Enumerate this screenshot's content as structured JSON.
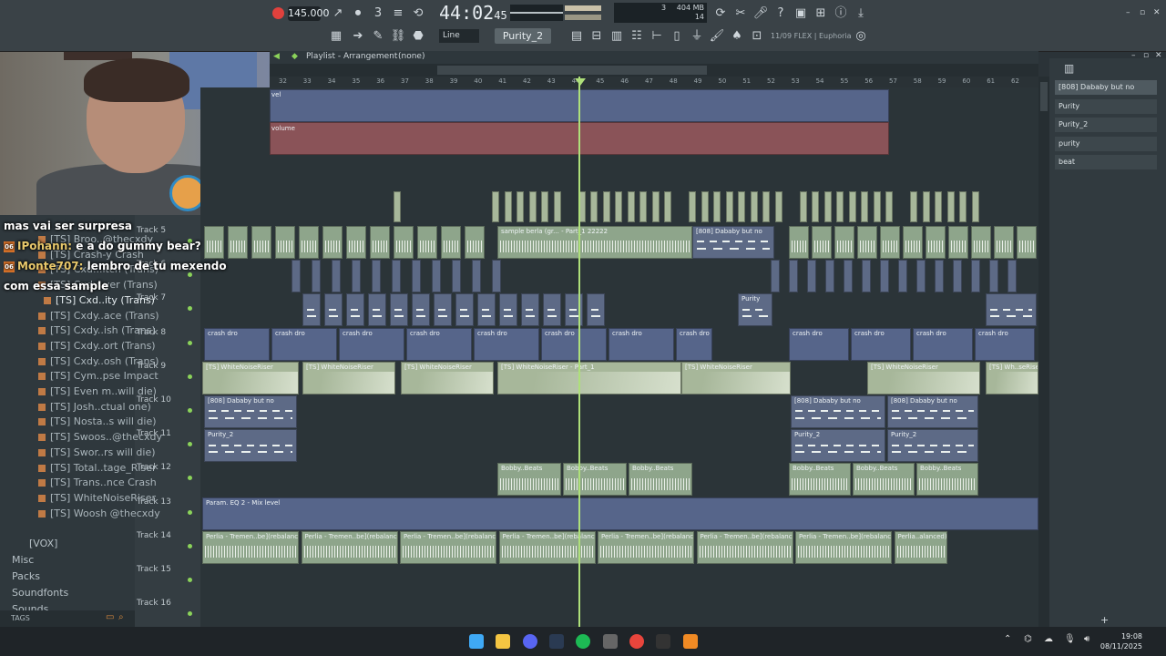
{
  "toolbar": {
    "tempo": "145.000",
    "time_main": "44:02",
    "time_sub": "45",
    "cpu_top": "404 MB",
    "cpu_mid": "3",
    "cpu_bot": "14",
    "pattern": "Purity_2",
    "tool_mode": "Line",
    "hint": "11/09 FLEX | Euphoria"
  },
  "playlist": {
    "title": "Playlist - Arrangement",
    "sub": "(none)",
    "ruler": [
      "32",
      "33",
      "34",
      "35",
      "36",
      "37",
      "38",
      "39",
      "40",
      "41",
      "42",
      "43",
      "44",
      "45",
      "46",
      "47",
      "48",
      "49",
      "50",
      "51",
      "52",
      "53",
      "54",
      "55",
      "56",
      "57",
      "58",
      "59",
      "60",
      "61",
      "62"
    ]
  },
  "tracks": [
    {
      "label": "Track 5"
    },
    {
      "label": "Track 6"
    },
    {
      "label": "Track 7"
    },
    {
      "label": "Track 8"
    },
    {
      "label": "Track 9"
    },
    {
      "label": "Track 10"
    },
    {
      "label": "Track 11"
    },
    {
      "label": "Track 12"
    },
    {
      "label": "Track 13"
    },
    {
      "label": "Track 14"
    },
    {
      "label": "Track 15"
    },
    {
      "label": "Track 16"
    }
  ],
  "clips": {
    "auto_top": "vel",
    "volume": "volume",
    "sample_a": "sample berla (gr... - Part_1 22222",
    "sample_b": "sample berla g...3123123 12312w",
    "dababy_main": "[808] Dababy but no",
    "crash": "crash dro",
    "riser": "[TS] WhiteNoiseRiser",
    "riser_part": "[TS] WhiteNoiseRiser - Part_1",
    "riser_last": "[TS] Wh..seRiser",
    "dababy": "[808] Dababy but no",
    "purity2": "Purity_2",
    "purity": "Purity",
    "bobby": "Bobby..Beats",
    "param": "Param. EQ 2 - Mix level",
    "perlia": "Perlia - Tremen..be](rebalanced)",
    "perlia_last": "Perlia..alanced)"
  },
  "browser": {
    "items": [
      "[TS] Broo..@thecxdy",
      "[TS] Crash-y Crash",
      "[TS] Cxd...itch (Trans)",
      "[TS] Cxdy..ver (Trans)",
      "[TS] Cxd..ity (Trans)",
      "[TS] Cxdy..ace (Trans)",
      "[TS] Cxdy..ish (Trans)",
      "[TS] Cxdy..ort (Trans)",
      "[TS] Cxdy..osh (Trans)",
      "[TS] Cym..pse Impact",
      "[TS] Even m..will die)",
      "[TS] Josh..ctual one)",
      "[TS] Nosta..s will die)",
      "[TS] Swoos..@thecxdy",
      "[TS] Swor..rs will die)",
      "[TS] Total..tage_Riser",
      "[TS] Trans..nce Crash",
      "[TS] WhiteNoiseRiser",
      "[TS] Woosh @thecxdy"
    ],
    "folders": [
      "[VOX]",
      "Misc",
      "Packs",
      "Soundfonts",
      "Sounds"
    ],
    "tags": "TAGS"
  },
  "channels": [
    "[808] Dababy but no",
    "Purity",
    "Purity_2",
    "purity",
    "beat"
  ],
  "chat": [
    {
      "user": "",
      "text": "mas vai ser surpresa"
    },
    {
      "user": "IPohann:",
      "text": "e a do gummy bear?"
    },
    {
      "user": "Monte707:",
      "text": "lembro de tu mexendo"
    },
    {
      "user": "",
      "text": "com essa sample"
    }
  ],
  "taskbar": {
    "time": "19:08",
    "date": "08/11/2025"
  }
}
